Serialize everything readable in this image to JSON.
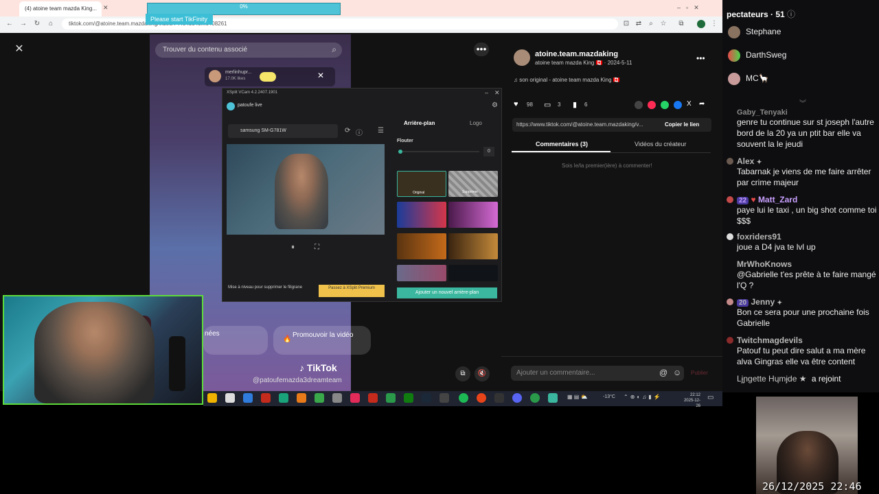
{
  "browser": {
    "tab1": "(4) atoine team mazda King...",
    "tab2": "...",
    "address": "tiktok.com/@atoine.team.mazdaking/video/744843840...6408261",
    "progress_label": "0%",
    "tikfinity_button": "Please start TikFinity"
  },
  "tiktok": {
    "search_placeholder": "Trouver du contenu associé",
    "author": {
      "username": "atoine.team.mazdaking",
      "meta": "atoine team mazda King 🇨🇦 · 2024-5-11",
      "sound": "♫ son original - atoine team mazda King 🇨🇦"
    },
    "stats": {
      "likes": "98",
      "comments": "3",
      "saves": "6"
    },
    "link": "https://www.tiktok.com/@atoine.team.mazdaking/v...",
    "copy_link": "Copier le lien",
    "tabs": {
      "comments": "Commentaires (3)",
      "creator_videos": "Vidéos du créateur"
    },
    "empty_comments": "Sois le/la premier(ière) à commenter!",
    "comment_placeholder": "Ajouter un commentaire...",
    "post": "Publier",
    "promote": "Promouvoir la vidéo",
    "data_btn": "nées",
    "brand": "TikTok",
    "handle": "@patoufemazda3dreamteam",
    "live_user": "merlinhupr...",
    "live_viewers": "17.0K likes"
  },
  "xsplit": {
    "title": "XSplit VCam 4.2.2407.1901",
    "account": "patoufe live",
    "device": "samsung SM-G781W",
    "tab_background": "Arrière-plan",
    "tab_logo": "Logo",
    "blur_label": "Flouter",
    "blur_value": "0",
    "thumb_original": "Original",
    "thumb_remove": "Supprimer",
    "upgrade_text": "Mise à niveau pour supprimer le filigrane",
    "premium_button": "Passez à XSplit Premium",
    "add_background": "Ajouter un nouvel arrière-plan"
  },
  "taskbar": {
    "temp": "-13°C",
    "time": "22:12",
    "date": "2025-12-26"
  },
  "chat": {
    "viewers_label": "pectateurs · 51",
    "viewers": [
      "Stephane",
      "DarthSweg",
      "MC🦙"
    ],
    "messages": [
      {
        "name": "Gaby_Tenyaki",
        "text": "genre tu continue sur st joseph l'autre bord de la 20 ya un ptit bar elle va souvent la le jeudi",
        "color": "#8a8a8a"
      },
      {
        "name": "Alex",
        "text": "Tabarnak je viens de me faire arrêter par crime majeur",
        "color": "#b9b9b9"
      },
      {
        "name": "Matt_Zard",
        "badge": "22",
        "text": "paye lui le taxi , un big shot comme toi $$$",
        "color": "#c9a0ff"
      },
      {
        "name": "foxriders91",
        "text": "joue a D4 jva te lvl up",
        "color": "#b9b9b9"
      },
      {
        "name": "MrWhoKnows",
        "text": "@Gabrielle t'es prête à te faire mangé l'Q ?",
        "color": "#b9b9b9"
      },
      {
        "name": "Jenny",
        "badge": "20",
        "text": "Bon ce sera pour une prochaine fois Gabrielle",
        "color": "#b9b9b9"
      },
      {
        "name": "Twitchmagdevils",
        "text": "Patouf tu peut dire salut a ma mère alva Gingras elle va être content",
        "color": "#b9b9b9"
      },
      {
        "name": "Lɉɲgette Hɥmɉde ★",
        "text": "a rejoint",
        "color": "#cccccc"
      }
    ]
  },
  "overlay_timestamp": "26/12/2025 22:46",
  "colors": {
    "accent_teal": "#4ec3d7",
    "chat_bg": "#0e0e10",
    "tiktok_bg": "#121212",
    "premium_yellow": "#f0c14b",
    "add_bg_teal": "#3ab79e"
  }
}
